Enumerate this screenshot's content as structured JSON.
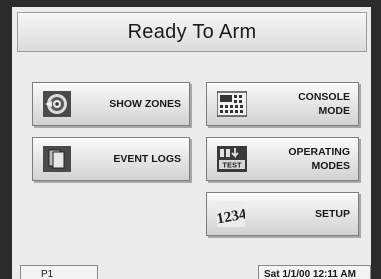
{
  "screen": {
    "title": "Ready To Arm"
  },
  "buttons": {
    "show_zones": "SHOW ZONES",
    "event_logs": "EVENT LOGS",
    "console_mode": "CONSOLE\nMODE",
    "operating_modes": "OPERATING\nMODES",
    "setup": "SETUP"
  },
  "icons": {
    "show_zones": "target-icon",
    "event_logs": "document-stack-icon",
    "console_mode": "keypad-icon",
    "operating_modes": "test-mode-icon",
    "setup": "numbers-setup-icon",
    "operating_modes_text": "TEST",
    "setup_digits": "1234"
  },
  "status_bar": {
    "partition": "P1",
    "datetime": "Sat 1/1/00 12:11 AM"
  }
}
